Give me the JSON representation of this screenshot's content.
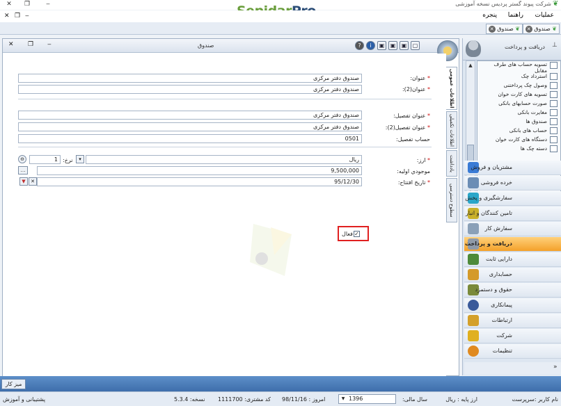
{
  "window": {
    "title": "شرکت پیوند گستر پردیس نسخه آموزشی",
    "brand_main": "Sepidar",
    "brand_accent": "Pro"
  },
  "menu": {
    "operations": "عملیات",
    "help": "راهنما",
    "window": "پنجره"
  },
  "doc_tabs": [
    {
      "label": "صندوق"
    },
    {
      "label": "صندوق"
    }
  ],
  "sidebar": {
    "title": "دریافت و پرداخت",
    "list_items": [
      "تسویه حساب های طرف مقابل",
      "استرداد چک",
      "وصول چک پرداختنی",
      "تسویه های کارت خوان",
      "صورت حسابهای بانکی",
      "مغایرت بانکی",
      "صندوق ها",
      "حساب های بانکی",
      "دستگاه های کارت خوان",
      "دسته چک ها"
    ],
    "modules": [
      {
        "label": "مشتریان و فروش",
        "color": "#3a7bd5"
      },
      {
        "label": "خرده فروشی",
        "color": "#6b8db5"
      },
      {
        "label": "سفارشگیری و پخش",
        "color": "#2aa6c9"
      },
      {
        "label": "تامین کنندگان و انبار",
        "color": "#c9b12a"
      },
      {
        "label": "سفارش کار",
        "color": "#8aa0b8"
      },
      {
        "label": "دریافت و پرداخت",
        "color": "#8f9aa8"
      },
      {
        "label": "دارایی ثابت",
        "color": "#4e8a3a"
      },
      {
        "label": "حسابداری",
        "color": "#d49a2a"
      },
      {
        "label": "حقوق و دستمزد",
        "color": "#7a8a3a"
      },
      {
        "label": "پیمانکاری",
        "color": "#3a5a9a"
      },
      {
        "label": "ارتباطات",
        "color": "#d4a02a"
      },
      {
        "label": "شرکت",
        "color": "#e0b020"
      },
      {
        "label": "تنظیمات",
        "color": "#e08a20"
      }
    ],
    "active_module": "دریافت و پرداخت"
  },
  "form": {
    "title": "صندوق",
    "tabs": {
      "general": "اطلاعات عمومی",
      "extra": "اطلاعات تکمیلی",
      "notes": "یادداشت",
      "access": "سطوح دسترسی"
    },
    "title_label": "عنوان:",
    "title_value": "صندوق دفتر مرکزی",
    "title2_label": "عنوان(2):",
    "title2_value": "صندوق دفتر مرکزی",
    "detail_title_label": "عنوان تفصیل:",
    "detail_title_value": "صندوق دفتر مرکزی",
    "detail_title2_label": "عنوان تفصیل(2):",
    "detail_title2_value": "صندوق دفتر مرکزی",
    "detail_account_label": "حساب تفصیل:",
    "detail_account_value": "0501",
    "currency_label": "ارز:",
    "currency_value": "ریال",
    "rate_label": "نرخ:",
    "rate_value": "1",
    "opening_balance_label": "موجودي اوليه:",
    "opening_balance_value": "9,500,000",
    "open_date_label": "تاریخ افتتاح:",
    "open_date_value": "95/12/30",
    "active_label": "فعال",
    "active_checked": "✓"
  },
  "taskbar": {
    "desktop": "میز کار"
  },
  "status": {
    "user": "نام کاربر :سرپرست",
    "base_currency": "ارز پایه : ریال",
    "fiscal_year_label": "سال مالی:",
    "fiscal_year": "1396",
    "today": "امروز : 98/11/16",
    "customer_code": "کد مشتری: 1111700",
    "version": "نسخه: 5.3.4",
    "support": "پشتیبانی و آموزش"
  }
}
